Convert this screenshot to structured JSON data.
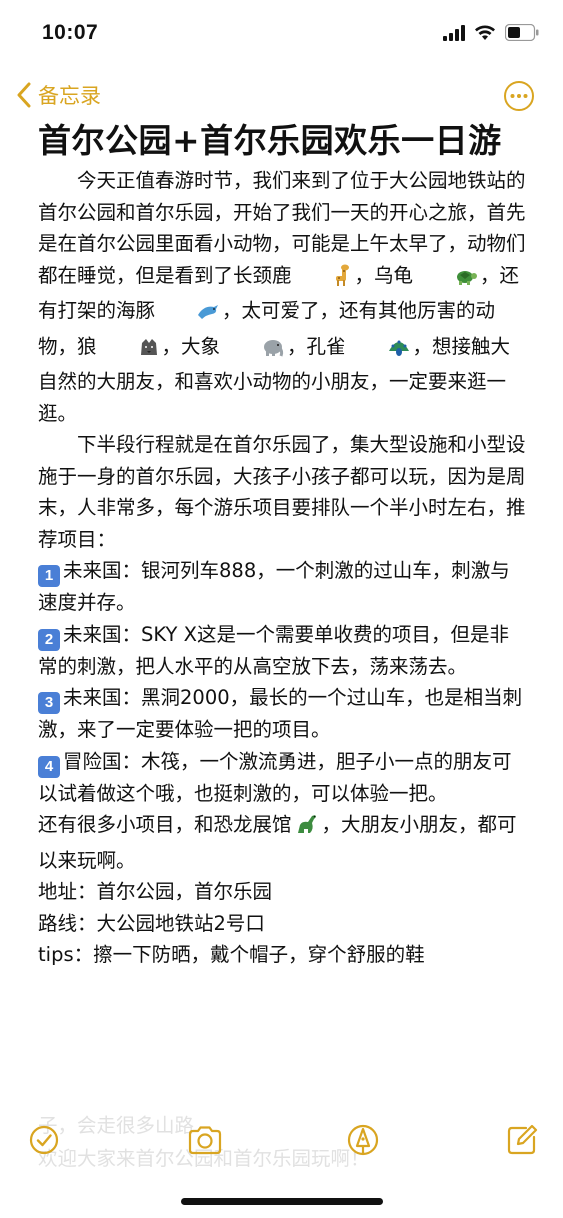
{
  "status": {
    "time": "10:07"
  },
  "nav": {
    "back_label": "备忘录"
  },
  "note": {
    "title": "首尔公园+首尔乐园欢乐一日游",
    "p1_a": "今天正值春游时节，我们来到了位于大公园地铁站的首尔公园和首尔乐园，开始了我们一天的开心之旅，首先是在首尔公园里面看小动物，可能是上午太早了，动物们都在睡觉，但是看到了长颈鹿",
    "p1_b": "，乌龟",
    "p1_c": "，还有打架的海豚",
    "p1_d": "，太可爱了，还有其他厉害的动物，狼",
    "p1_e": "，大象",
    "p1_f": "，孔雀",
    "p1_g": "，想接触大自然的大朋友，和喜欢小动物的小朋友，一定要来逛一逛。",
    "p2": "下半段行程就是在首尔乐园了，集大型设施和小型设施于一身的首尔乐园，大孩子小孩子都可以玩，因为是周末，人非常多，每个游乐项目要排队一个半小时左右，推荐项目：",
    "items": [
      {
        "num": "1",
        "text": "未来国：银河列车888，一个刺激的过山车，刺激与速度并存。"
      },
      {
        "num": "2",
        "text": "未来国：SKY X这是一个需要单收费的项目，但是非常的刺激，把人水平的从高空放下去，荡来荡去。"
      },
      {
        "num": "3",
        "text": "未来国：黑洞2000，最长的一个过山车，也是相当刺激，来了一定要体验一把的项目。"
      },
      {
        "num": "4",
        "text": "冒险国：木筏，一个激流勇进，胆子小一点的朋友可以试着做这个哦，也挺刺激的，可以体验一把。"
      }
    ],
    "p3_a": "还有很多小项目，和恐龙展馆",
    "p3_b": "，大朋友小朋友，都可以来玩啊。",
    "address": "地址：首尔公园，首尔乐园",
    "route": "路线：大公园地铁站2号口",
    "tips": "tips：擦一下防晒，戴个帽子，穿个舒服的鞋",
    "ghost_1": "子，会走很多山路",
    "ghost_2": "欢迎大家来首尔公园和首尔乐园玩啊！"
  },
  "icons": {
    "accent": "#d9a521",
    "giraffe": "giraffe-emoji",
    "turtle": "turtle-emoji",
    "dolphin": "dolphin-emoji",
    "wolf": "wolf-emoji",
    "elephant": "elephant-emoji",
    "peacock": "peacock-emoji",
    "dinosaur": "dinosaur-emoji"
  }
}
